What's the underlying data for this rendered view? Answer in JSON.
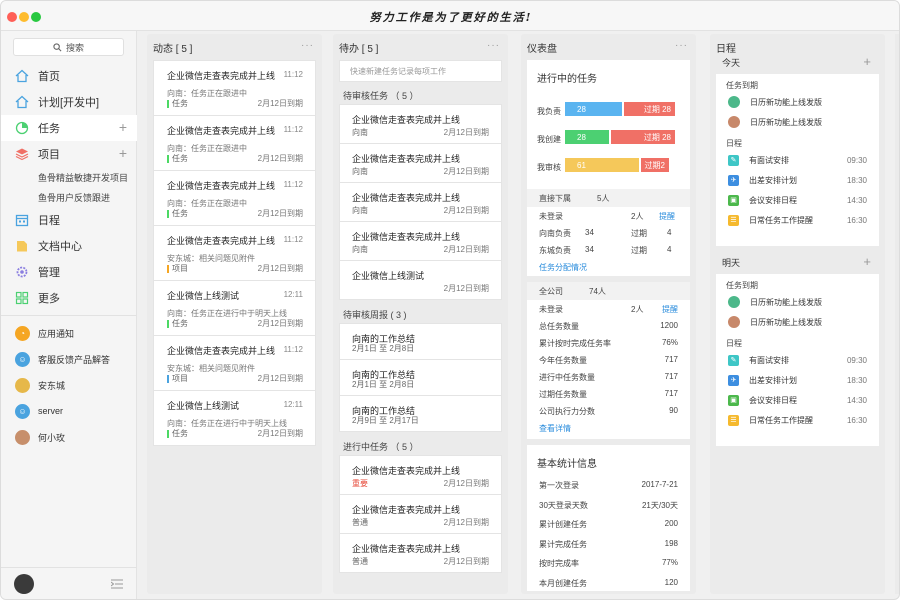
{
  "app": {
    "title": "努力工作是为了更好的生活!"
  },
  "sidebar": {
    "search_label": "搜索",
    "nav": [
      {
        "label": "首页",
        "icon": "home-icon"
      },
      {
        "label": "计划[开发中]",
        "icon": "home-icon"
      },
      {
        "label": "任务",
        "icon": "pie-chart-icon"
      },
      {
        "label": "项目",
        "icon": "layers-icon"
      },
      {
        "label": "日程",
        "icon": "calendar-icon"
      },
      {
        "label": "文档中心",
        "icon": "folder-icon"
      },
      {
        "label": "管理",
        "icon": "gear-icon"
      },
      {
        "label": "更多",
        "icon": "grid-icon"
      }
    ],
    "projects": [
      "鱼骨精益敏捷开发项目",
      "鱼骨用户反馈跟进"
    ],
    "contacts": [
      {
        "label": "应用通知",
        "color": "#f5a623"
      },
      {
        "label": "客服反馈产品解答",
        "color": "#4aa3df"
      },
      {
        "label": "安东城",
        "color": "#e6b84a"
      },
      {
        "label": "server",
        "color": "#4aa3df"
      },
      {
        "label": "何小玫",
        "color": "#c78f6b"
      }
    ]
  },
  "activity": {
    "header": "动态 [ 5 ]",
    "cards": [
      {
        "title": "企业微信走查表完成并上线",
        "time": "11:12",
        "sub": "向南：任务正在跟进中",
        "tag": "任务",
        "tag_color": "#4cd964",
        "date": "2月12日到期"
      },
      {
        "title": "企业微信走查表完成并上线",
        "time": "11:12",
        "sub": "向南：任务正在跟进中",
        "tag": "任务",
        "tag_color": "#4cd964",
        "date": "2月12日到期"
      },
      {
        "title": "企业微信走查表完成并上线",
        "time": "11:12",
        "sub": "向南：任务正在跟进中",
        "tag": "任务",
        "tag_color": "#4cd964",
        "date": "2月12日到期"
      },
      {
        "title": "企业微信走查表完成并上线",
        "time": "11:12",
        "sub": "安东城：相关问题见附件",
        "tag": "项目",
        "tag_color": "#f5a623",
        "date": "2月12日到期"
      },
      {
        "title": "企业微信上线测试",
        "time": "12:11",
        "sub": "向南：任务正在进行中于明天上线",
        "tag": "任务",
        "tag_color": "#4cd964",
        "date": "2月12日到期"
      },
      {
        "title": "企业微信走查表完成并上线",
        "time": "11:12",
        "sub": "安东城：相关问题见附件",
        "tag": "项目",
        "tag_color": "#4aa3df",
        "date": "2月12日到期"
      },
      {
        "title": "企业微信上线测试",
        "time": "12:11",
        "sub": "向南：任务正在进行中于明天上线",
        "tag": "任务",
        "tag_color": "#4cd964",
        "date": "2月12日到期"
      }
    ]
  },
  "todo": {
    "header": "待办 [ 5 ]",
    "quick_placeholder": "快速新建任务记录每项工作",
    "groups": [
      {
        "label": "待审核任务 （ 5 ）",
        "items": [
          {
            "title": "企业微信走查表完成并上线",
            "sub": "向南",
            "date": "2月12日到期"
          },
          {
            "title": "企业微信走查表完成并上线",
            "sub": "向南",
            "date": "2月12日到期"
          },
          {
            "title": "企业微信走查表完成并上线",
            "sub": "向南",
            "date": "2月12日到期"
          },
          {
            "title": "企业微信走查表完成并上线",
            "sub": "向南",
            "date": "2月12日到期"
          },
          {
            "title": "企业微信上线测试",
            "sub": "",
            "date": "2月12日到期"
          }
        ]
      },
      {
        "label": "待审核周报 ( 3 )",
        "items": [
          {
            "title": "向南的工作总结",
            "sub": "2月1日 至 2月8日",
            "date": ""
          },
          {
            "title": "向南的工作总结",
            "sub": "2月1日 至 2月8日",
            "date": ""
          },
          {
            "title": "向南的工作总结",
            "sub": "2月9日 至 2月17日",
            "date": ""
          }
        ]
      },
      {
        "label": "进行中任务 （ 5 ）",
        "items": [
          {
            "title": "企业微信走查表完成并上线",
            "sub": "重要",
            "urgent": true,
            "date": "2月12日到期"
          },
          {
            "title": "企业微信走查表完成并上线",
            "sub": "普通",
            "date": "2月12日到期"
          },
          {
            "title": "企业微信走查表完成并上线",
            "sub": "普通",
            "date": "2月12日到期"
          }
        ]
      }
    ]
  },
  "dashboard": {
    "header": "仪表盘",
    "in_progress_title": "进行中的任务",
    "bars": [
      {
        "label": "我负责",
        "value": "28",
        "over_label": "过期 28",
        "value_pct": 0.49,
        "over_pct": 0.44,
        "color": "#5ab4f0"
      },
      {
        "label": "我创建",
        "value": "28",
        "over_label": "过期 28",
        "value_pct": 0.38,
        "over_pct": 0.55,
        "color": "#4cd072"
      },
      {
        "label": "我审核",
        "value": "61",
        "over_label": "过期2",
        "value_pct": 0.64,
        "over_pct": 0.24,
        "color": "#f5c85a"
      }
    ],
    "direct": {
      "head_label": "直接下属",
      "head_value": "5人",
      "rows": [
        {
          "a": "未登录",
          "b": "",
          "c": "2人",
          "d": "提醒",
          "d_link": true
        },
        {
          "a": "向南负责",
          "b": "34",
          "c": "过期",
          "d": "4",
          "d_link": false
        },
        {
          "a": "东城负责",
          "b": "34",
          "c": "过期",
          "d": "4",
          "d_link": false
        }
      ],
      "link": "任务分配情况"
    },
    "company": {
      "head_label": "全公司",
      "head_value": "74人",
      "rows": [
        {
          "k": "未登录",
          "v": "2人",
          "extra": "提醒"
        },
        {
          "k": "总任务数量",
          "v": "1200"
        },
        {
          "k": "累计按时完成任务率",
          "v": "76%"
        },
        {
          "k": "今年任务数量",
          "v": "717"
        },
        {
          "k": "进行中任务数量",
          "v": "717"
        },
        {
          "k": "过期任务数量",
          "v": "717"
        },
        {
          "k": "公司执行力分数",
          "v": "90"
        }
      ],
      "link": "查看详情"
    },
    "basic": {
      "title": "基本统计信息",
      "rows": [
        {
          "k": "第一次登录",
          "v": "2017-7-21"
        },
        {
          "k": "30天登录天数",
          "v": "21天/30天"
        },
        {
          "k": "累计创建任务",
          "v": "200"
        },
        {
          "k": "累计完成任务",
          "v": "198"
        },
        {
          "k": "按时完成率",
          "v": "77%"
        },
        {
          "k": "本月创建任务",
          "v": "120"
        }
      ]
    }
  },
  "schedule": {
    "header": "日程",
    "days": [
      {
        "label": "今天",
        "due_title": "任务到期",
        "due": [
          {
            "label": "日历新功能上线发版",
            "color": "#4cb88a"
          },
          {
            "label": "日历新功能上线发版",
            "color": "#c7886a"
          }
        ],
        "sched_title": "日程",
        "events": [
          {
            "label": "有面试安排",
            "time": "09:30",
            "color": "#3ec6c6",
            "icon": "interview-icon"
          },
          {
            "label": "出差安排计划",
            "time": "18:30",
            "color": "#3d8ee0",
            "icon": "travel-icon"
          },
          {
            "label": "会议安排日程",
            "time": "14:30",
            "color": "#4cb84c",
            "icon": "meeting-icon"
          },
          {
            "label": "日常任务工作提醒",
            "time": "16:30",
            "color": "#f5b92e",
            "icon": "reminder-icon"
          }
        ]
      },
      {
        "label": "明天",
        "due_title": "任务到期",
        "due": [
          {
            "label": "日历新功能上线发版",
            "color": "#4cb88a"
          },
          {
            "label": "日历新功能上线发版",
            "color": "#c7886a"
          }
        ],
        "sched_title": "日程",
        "events": [
          {
            "label": "有面试安排",
            "time": "09:30",
            "color": "#3ec6c6",
            "icon": "interview-icon"
          },
          {
            "label": "出差安排计划",
            "time": "18:30",
            "color": "#3d8ee0",
            "icon": "travel-icon"
          },
          {
            "label": "会议安排日程",
            "time": "14:30",
            "color": "#4cb84c",
            "icon": "meeting-icon"
          },
          {
            "label": "日常任务工作提醒",
            "time": "16:30",
            "color": "#f5b92e",
            "icon": "reminder-icon"
          }
        ]
      }
    ]
  }
}
